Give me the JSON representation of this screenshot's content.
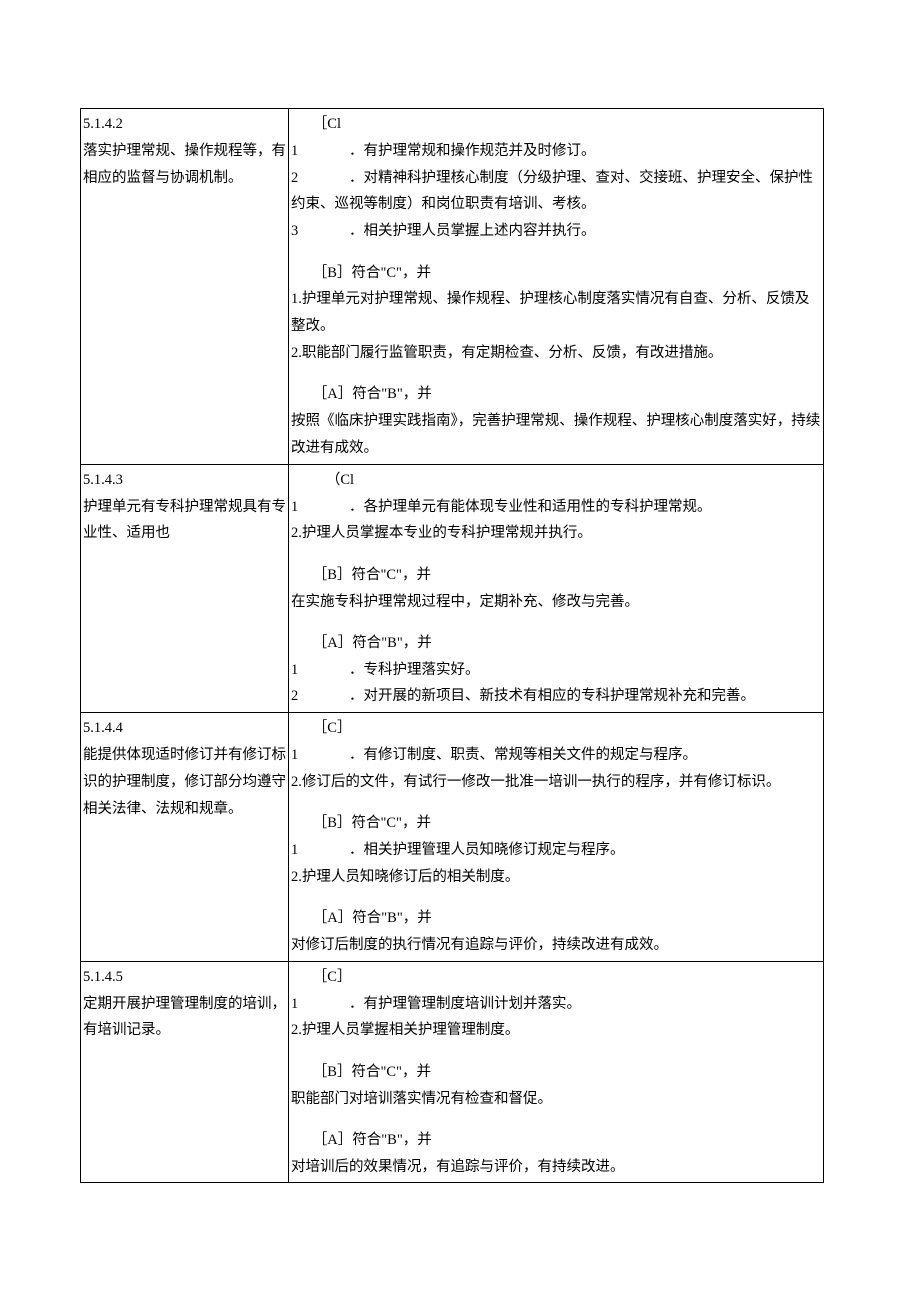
{
  "rows": [
    {
      "id": "5.1.4.2",
      "title": "落实护理常规、操作规程等，有相应的监督与协调机制。",
      "c_label": "［Cl",
      "c_items": [
        {
          "n": "1",
          "gap": true,
          "text": "．有护理常规和操作规范并及时修订。"
        },
        {
          "n": "2",
          "gap": true,
          "text": "．对精神科护理核心制度（分级护理、查对、交接班、护理安全、保护性约束、巡视等制度）和岗位职责有培训、考核。"
        },
        {
          "n": "3",
          "gap": true,
          "text": "．相关护理人员掌握上述内容并执行。"
        }
      ],
      "b_label": "［B］符合\"C\"，并",
      "b_items": [
        {
          "n": "1.",
          "gap": false,
          "text": "护理单元对护理常规、操作规程、护理核心制度落实情况有自查、分析、反馈及整改。"
        },
        {
          "n": "2.",
          "gap": false,
          "text": "职能部门履行监管职责，有定期检查、分析、反馈，有改进措施。"
        }
      ],
      "a_label": "［A］符合\"B\"，并",
      "a_text": "按照《临床护理实践指南》，完善护理常规、操作规程、护理核心制度落实好，持续改进有成效。"
    },
    {
      "id": "5.1.4.3",
      "title": "护理单元有专科护理常规具有专业性、适用也",
      "c_label": "（Cl",
      "c_label_wide": true,
      "c_items": [
        {
          "n": "1",
          "gap": true,
          "text": "．各护理单元有能体现专业性和适用性的专科护理常规。"
        },
        {
          "n": "2.",
          "gap": false,
          "text": "护理人员掌握本专业的专科护理常规并执行。"
        }
      ],
      "b_label": "［B］符合\"C\"，并",
      "b_text": "在实施专科护理常规过程中，定期补充、修改与完善。",
      "a_label": "［A］符合\"B\"，并",
      "a_items": [
        {
          "n": "1",
          "gap": true,
          "text": "．专科护理落实好。"
        },
        {
          "n": "2",
          "gap": true,
          "text": "．对开展的新项目、新技术有相应的专科护理常规补充和完善。"
        }
      ]
    },
    {
      "id": "5.1.4.4",
      "title": "能提供体现适时修订并有修订标识的护理制度，修订部分均遵守相关法律、法规和规章。",
      "c_label": "［C］",
      "c_items": [
        {
          "n": "1",
          "gap": true,
          "text": "．有修订制度、职责、常规等相关文件的规定与程序。"
        },
        {
          "n": "2.",
          "gap": false,
          "text": "修订后的文件，有试行一修改一批准一培训一执行的程序，并有修订标识。"
        }
      ],
      "b_label": "［B］符合\"C\"，并",
      "b_items": [
        {
          "n": "1",
          "gap": true,
          "text": "．相关护理管理人员知晓修订规定与程序。"
        },
        {
          "n": "2.",
          "gap": false,
          "text": "护理人员知晓修订后的相关制度。"
        }
      ],
      "a_label": "［A］符合\"B\"，并",
      "a_text": "对修订后制度的执行情况有追踪与评价，持续改进有成效。"
    },
    {
      "id": "5.1.4.5",
      "title": "定期开展护理管理制度的培训，有培训记录。",
      "c_label": "［C］",
      "c_items": [
        {
          "n": "1",
          "gap": true,
          "text": "．有护理管理制度培训计划并落实。"
        },
        {
          "n": "2.",
          "gap": false,
          "text": "护理人员掌握相关护理管理制度。"
        }
      ],
      "b_label": "［B］符合\"C\"，并",
      "b_text": "职能部门对培训落实情况有检查和督促。",
      "a_label": "［A］符合\"B\"，并",
      "a_text": "对培训后的效果情况，有追踪与评价，有持续改进。"
    }
  ]
}
